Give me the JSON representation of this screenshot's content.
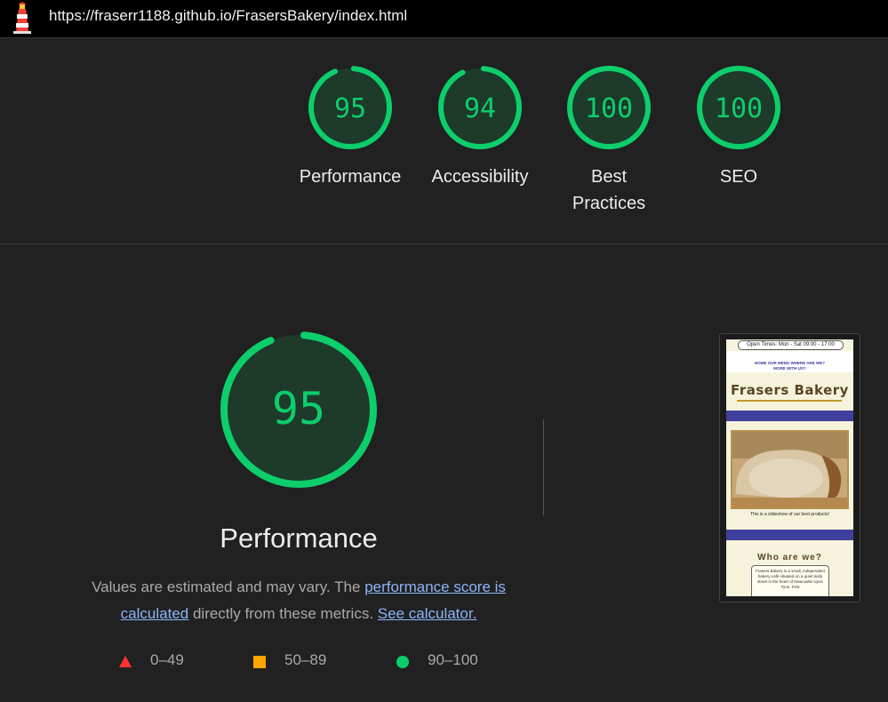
{
  "browser": {
    "url": "https://fraserr1188.github.io/FrasersBakery/index.html",
    "logo_icon": "lighthouse-icon"
  },
  "scores": [
    {
      "label": "Performance",
      "value": "95",
      "fraction": 0.95
    },
    {
      "label": "Accessibility",
      "value": "94",
      "fraction": 0.94
    },
    {
      "label": "Best Practices",
      "value": "100",
      "fraction": 1.0
    },
    {
      "label": "SEO",
      "value": "100",
      "fraction": 1.0
    }
  ],
  "performance": {
    "score": "95",
    "fraction": 0.95,
    "title": "Performance",
    "desc_start": "Values are estimated and may vary. The ",
    "link1": "performance score is calculated",
    "desc_mid": " directly from these metrics. ",
    "link2": "See calculator."
  },
  "legend": [
    {
      "range": "0–49",
      "icon": "triangle-icon",
      "color": "#ff3333"
    },
    {
      "range": "50–89",
      "icon": "square-icon",
      "color": "#ffa400"
    },
    {
      "range": "90–100",
      "icon": "circle-icon",
      "color": "#0cce6b"
    }
  ],
  "colors": {
    "pass": "#0cce6b",
    "gauge_fill": "#1e3a2b",
    "background": "#212121",
    "link": "#8ab4f8"
  },
  "screenshot": {
    "hours": "Open Times: Mon - Sat 09:00 - 17:00",
    "nav_line1": "HOME   OUR MENU   WHERE ARE WE?",
    "nav_line2": "MORE WITH US?",
    "site_title": "Frasers Bakery",
    "caption": "This is a slideshow of our best products!",
    "who_title": "Who are we?",
    "who_text": "Frasers Bakery is a small, independent bakery-café situated on a quiet leafy street in the heart of Newcastle Upon Tyne. First"
  }
}
